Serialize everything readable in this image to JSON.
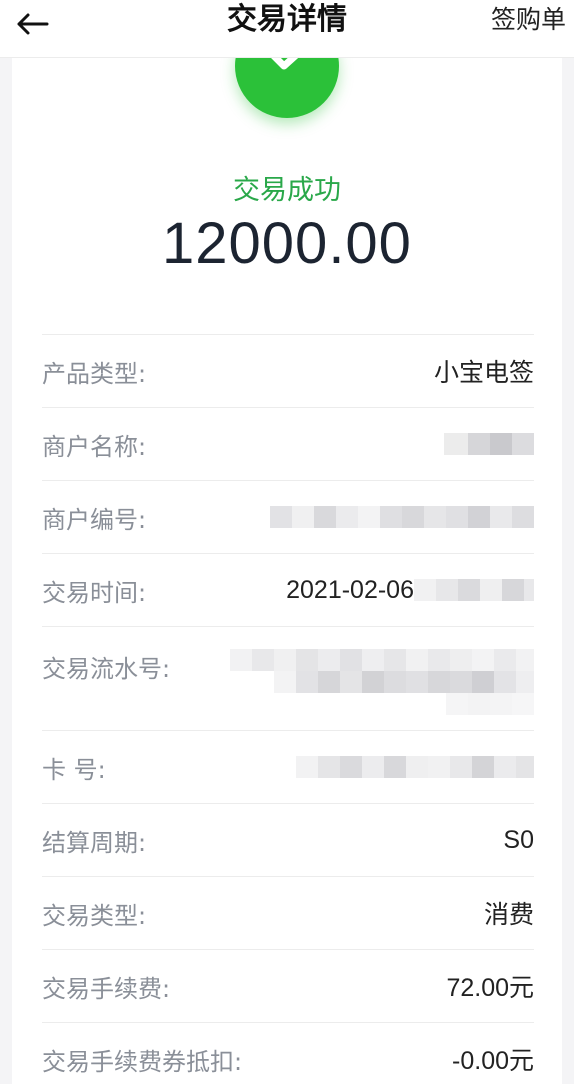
{
  "header": {
    "title": "交易详情",
    "right_action": "签购单",
    "back_icon": "arrow-left-icon"
  },
  "result": {
    "status": "交易成功",
    "amount": "12000.00",
    "icon": "check-circle-icon",
    "accent_color": "#2bc139"
  },
  "details": [
    {
      "label": "产品类型:",
      "value": "小宝电签"
    },
    {
      "label": "商户名称:",
      "value": ""
    },
    {
      "label": "商户编号:",
      "value": ""
    },
    {
      "label": "交易时间:",
      "value": "2021-02-06"
    },
    {
      "label": "交易流水号:",
      "value": ""
    },
    {
      "label": "卡  号:",
      "value": ""
    },
    {
      "label": "结算周期:",
      "value": "S0"
    },
    {
      "label": "交易类型:",
      "value": "消费"
    },
    {
      "label": "交易手续费:",
      "value": "72.00元"
    },
    {
      "label": "交易手续费券抵扣:",
      "value": "-0.00元"
    }
  ]
}
